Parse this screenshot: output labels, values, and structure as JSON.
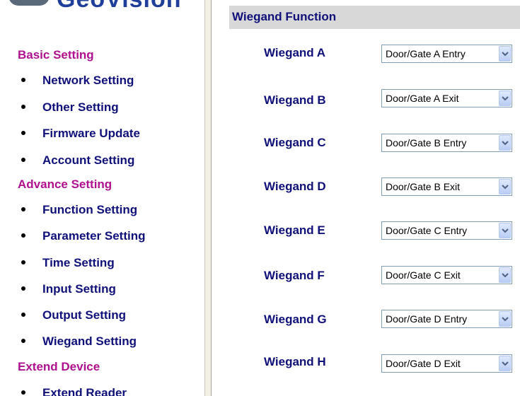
{
  "logo": {
    "text": "GeoVision"
  },
  "sidebar": {
    "sections": [
      {
        "heading": "Basic Setting",
        "items": [
          "Network Setting",
          "Other Setting",
          "Firmware Update",
          "Account Setting"
        ]
      },
      {
        "heading": "Advance Setting",
        "items": [
          "Function Setting",
          "Parameter Setting",
          "Time Setting",
          "Input Setting",
          "Output Setting",
          "Wiegand Setting"
        ]
      },
      {
        "heading": "Extend Device",
        "items": [
          "Extend Reader"
        ]
      }
    ]
  },
  "main": {
    "section_title": "Wiegand Function",
    "rows": [
      {
        "label": "Wiegand A",
        "value": "Door/Gate A Entry"
      },
      {
        "label": "Wiegand B",
        "value": "Door/Gate A Exit"
      },
      {
        "label": "Wiegand C",
        "value": "Door/Gate B Entry"
      },
      {
        "label": "Wiegand D",
        "value": "Door/Gate B Exit"
      },
      {
        "label": "Wiegand E",
        "value": "Door/Gate C Entry"
      },
      {
        "label": "Wiegand F",
        "value": "Door/Gate C Exit"
      },
      {
        "label": "Wiegand G",
        "value": "Door/Gate D Entry"
      },
      {
        "label": "Wiegand H",
        "value": "Door/Gate D Exit"
      }
    ]
  },
  "colors": {
    "section_heading": "#b0108f",
    "nav_text": "#10107a",
    "section_bar": "#d8d8d8"
  }
}
